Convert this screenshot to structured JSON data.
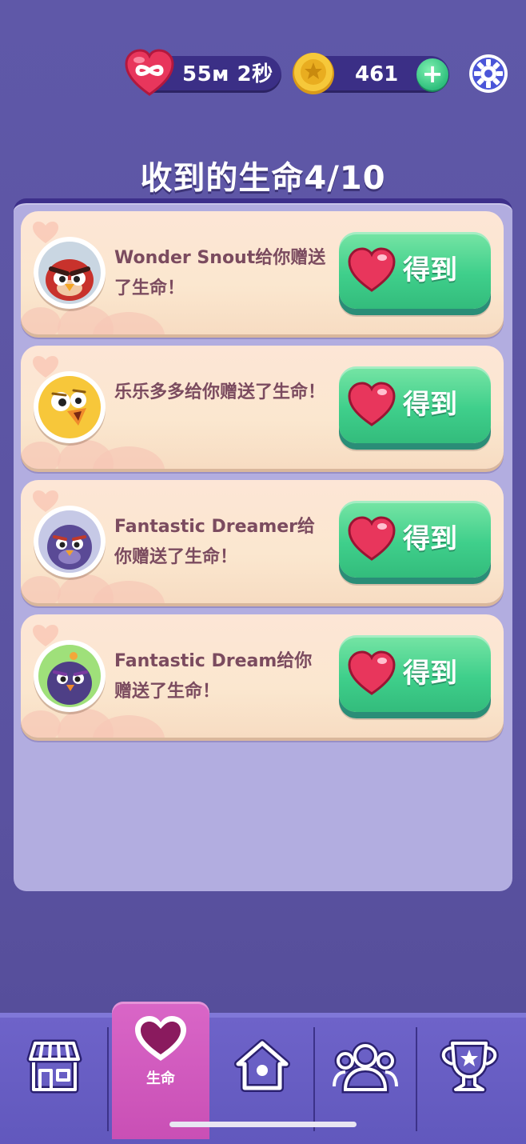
{
  "header": {
    "lives_timer": "55м 2秒",
    "coins": "461",
    "add_coins_label": "+"
  },
  "title": "收到的生命4/10",
  "gifts": [
    {
      "message": "Wonder Snout给你赠送了生命！",
      "button_label": "得到",
      "avatar": "red-bird-avatar"
    },
    {
      "message": "乐乐多多给你赠送了生命！",
      "button_label": "得到",
      "avatar": "yellow-bird-avatar"
    },
    {
      "message": "Fantastic Dreamer给你赠送了生命！",
      "button_label": "得到",
      "avatar": "purple-bird-avatar"
    },
    {
      "message": "Fantastic Dream给你赠送了生命！",
      "button_label": "得到",
      "avatar": "purple-bird-green-bg-avatar"
    }
  ],
  "nav": {
    "items": [
      {
        "name": "shop",
        "icon": "shop-icon"
      },
      {
        "name": "lives",
        "icon": "heart-icon",
        "label": "生命",
        "active": true
      },
      {
        "name": "home",
        "icon": "home-icon"
      },
      {
        "name": "friends",
        "icon": "friends-icon"
      },
      {
        "name": "trophy",
        "icon": "trophy-icon"
      }
    ]
  },
  "colors": {
    "background": "#5f58a8",
    "panel": "#b2ade0",
    "button_green": "#3fcf8b",
    "nav_active": "#d966c7",
    "message_text": "#7b4b5f"
  }
}
